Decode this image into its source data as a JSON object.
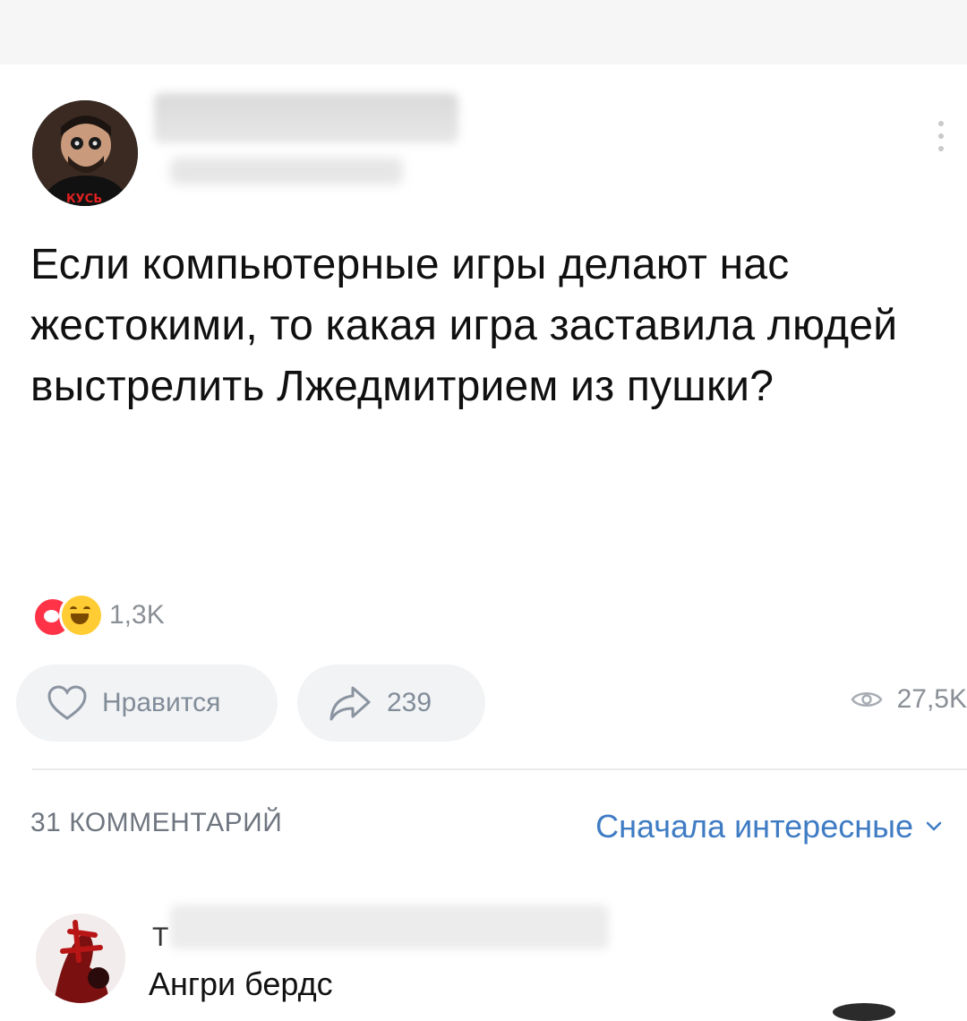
{
  "post": {
    "text": "Если компьютерные игры делают нас жестокими, то какая игра заставила людей выстрелить Лжедмитрием из пушки?",
    "avatar_text": "КУСЬ",
    "reactions": {
      "icons": [
        "heart-reaction",
        "laughing-face-reaction"
      ],
      "count": "1,3K"
    },
    "actions": {
      "like_label": "Нравится",
      "share_count": "239",
      "views_count": "27,5K"
    }
  },
  "comments": {
    "count_label": "31 КОММЕНТАРИЙ",
    "sort_label": "Сначала интересные",
    "items": [
      {
        "author_initial": "Т",
        "text": "Ангри бердс"
      }
    ]
  },
  "colors": {
    "accent": "#3f7cc4",
    "heart": "#ff3347",
    "muted": "#818c99",
    "pill_bg": "#f2f3f5"
  }
}
